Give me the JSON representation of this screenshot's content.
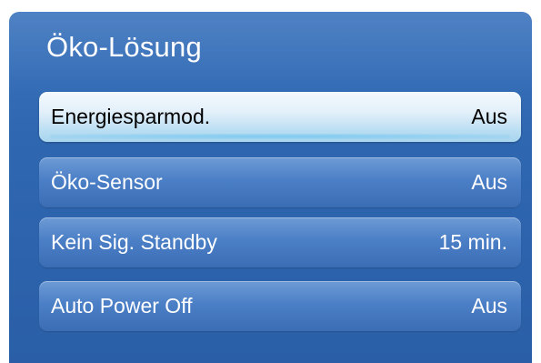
{
  "menu": {
    "title": "Öko-Lösung",
    "items": [
      {
        "label": "Energiesparmod.",
        "value": "Aus",
        "selected": true
      },
      {
        "label": "Öko-Sensor",
        "value": "Aus",
        "selected": false
      },
      {
        "label": "Kein Sig. Standby",
        "value": "15 min.",
        "selected": false
      },
      {
        "label": "Auto Power Off",
        "value": "Aus",
        "selected": false
      }
    ]
  },
  "colors": {
    "panel": "#2f67b1",
    "item": "#4b7fc6",
    "selected_item": "#d6ebf8",
    "text": "#ffffff",
    "selected_text": "#000000"
  }
}
